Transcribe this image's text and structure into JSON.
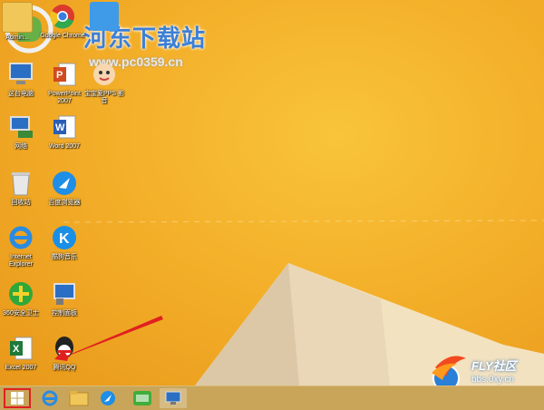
{
  "watermark": {
    "title": "河东下载站",
    "url": "www.pc0359.cn"
  },
  "desktop_icons": [
    {
      "id": "admin",
      "label": "Admin...",
      "icon": "folder-icon"
    },
    {
      "id": "chrome",
      "label": "Google Chrome",
      "icon": "chrome-icon"
    },
    {
      "id": "mydoc",
      "label": "",
      "icon": "blue-app-icon"
    },
    {
      "id": "computer",
      "label": "这台电脑",
      "icon": "computer-icon"
    },
    {
      "id": "ppt",
      "label": "PowerPoint 2007",
      "icon": "powerpoint-icon"
    },
    {
      "id": "pps",
      "label": "宝宝爱PPS 影音",
      "icon": "baby-app-icon"
    },
    {
      "id": "network",
      "label": "网络",
      "icon": "network-icon"
    },
    {
      "id": "word",
      "label": "Word 2007",
      "icon": "word-icon"
    },
    {
      "id": "recycle",
      "label": "回收站",
      "icon": "recycle-bin-icon"
    },
    {
      "id": "browser",
      "label": "百度浏览器",
      "icon": "browser-icon"
    },
    {
      "id": "ie",
      "label": "Internet Explorer",
      "icon": "ie-icon"
    },
    {
      "id": "kugou",
      "label": "酷狗音乐",
      "icon": "kugou-icon"
    },
    {
      "id": "360",
      "label": "360安全卫士",
      "icon": "360-safe-icon"
    },
    {
      "id": "control",
      "label": "控制面板",
      "icon": "control-panel-icon"
    },
    {
      "id": "excel",
      "label": "Excel 2007",
      "icon": "excel-icon"
    },
    {
      "id": "qq",
      "label": "腾讯QQ",
      "icon": "qq-icon"
    }
  ],
  "watermark_fly": {
    "title": "FLY社区",
    "url": "bbs.0xy.cn"
  },
  "taskbar": {
    "items": [
      {
        "name": "start-button",
        "icon": "windows-logo-icon"
      },
      {
        "name": "ie-taskbar",
        "icon": "ie-icon"
      },
      {
        "name": "file-explorer-taskbar",
        "icon": "folder-icon"
      },
      {
        "name": "browser-taskbar",
        "icon": "compass-icon"
      },
      {
        "name": "iqiyi-taskbar",
        "icon": "iqiyi-icon"
      },
      {
        "name": "control-panel-taskbar",
        "icon": "control-panel-icon"
      }
    ]
  },
  "colors": {
    "accent_red": "#e02020",
    "wallpaper": "#f4b02a",
    "taskbar": "#c9a55a"
  }
}
